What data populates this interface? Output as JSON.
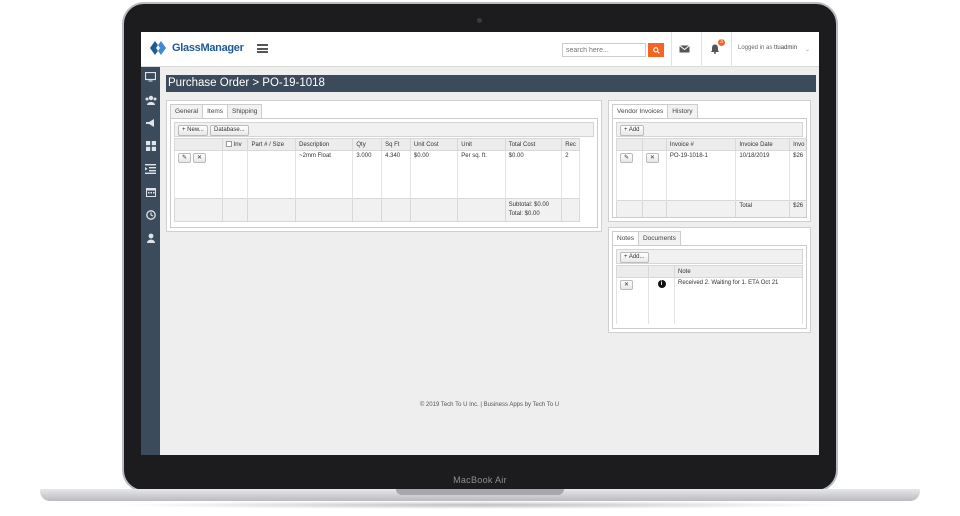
{
  "device": {
    "label": "MacBook Air"
  },
  "header": {
    "logo_text": "GlassManager",
    "search_placeholder": "search here...",
    "notification_count": "3",
    "user_prefix": "Logged in as",
    "username": "ttuadmin",
    "icons": [
      "menu-icon",
      "search-icon",
      "mail-icon",
      "bell-icon",
      "chevron-down-icon"
    ]
  },
  "sidebar": {
    "items": [
      {
        "icon": "monitor-icon"
      },
      {
        "icon": "users-icon"
      },
      {
        "icon": "megaphone-icon"
      },
      {
        "icon": "grid-icon"
      },
      {
        "icon": "indent-icon"
      },
      {
        "icon": "calendar-icon"
      },
      {
        "icon": "clock-icon"
      },
      {
        "icon": "user-icon"
      }
    ]
  },
  "page": {
    "title": "Purchase Order > PO-19-1018"
  },
  "order_panel": {
    "tabs": [
      "General",
      "Items",
      "Shipping"
    ],
    "active_tab": "Items",
    "buttons": {
      "new": "New...",
      "database": "Database..."
    },
    "inv_label": "Inv",
    "columns": [
      "Part # / Size",
      "Description",
      "Qty",
      "Sq Ft",
      "Unit Cost",
      "Unit",
      "Total Cost",
      "Rec"
    ],
    "rows": [
      {
        "part": "",
        "description": "~2mm Float",
        "qty": "3.000",
        "sqft": "4.340",
        "unit_cost": "$0.00",
        "unit": "Per sq. ft.",
        "total_cost": "$0.00",
        "rec": "2"
      }
    ],
    "subtotal": "Subtotal: $0.00",
    "total": "Total: $0.00"
  },
  "invoices_panel": {
    "tabs": [
      "Vendor Invoices",
      "History"
    ],
    "active_tab": "Vendor Invoices",
    "add_label": "Add",
    "columns": [
      "Invoice #",
      "Invoice Date",
      "Invo"
    ],
    "rows": [
      {
        "number": "PO-19-1018-1",
        "date": "10/18/2019",
        "amount": "$26"
      }
    ],
    "total_label": "Total",
    "total_value": "$26"
  },
  "notes_panel": {
    "tabs": [
      "Notes",
      "Documents"
    ],
    "active_tab": "Notes",
    "add_label": "Add...",
    "columns": [
      "Note"
    ],
    "rows": [
      {
        "note": "Received 2. Waiting for 1. ETA Oct 21"
      }
    ]
  },
  "footer": {
    "text": "© 2019 Tech To U Inc. | Business Apps by Tech To U"
  }
}
